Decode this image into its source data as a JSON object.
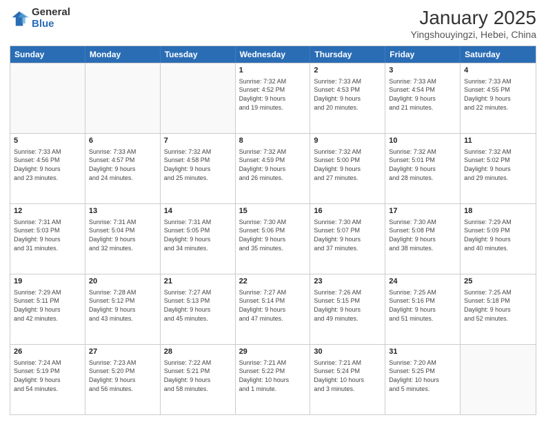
{
  "logo": {
    "general": "General",
    "blue": "Blue"
  },
  "header": {
    "month": "January 2025",
    "location": "Yingshouyingzi, Hebei, China"
  },
  "days_of_week": [
    "Sunday",
    "Monday",
    "Tuesday",
    "Wednesday",
    "Thursday",
    "Friday",
    "Saturday"
  ],
  "weeks": [
    [
      {
        "day": "",
        "info": "",
        "empty": true
      },
      {
        "day": "",
        "info": "",
        "empty": true
      },
      {
        "day": "",
        "info": "",
        "empty": true
      },
      {
        "day": "1",
        "info": "Sunrise: 7:32 AM\nSunset: 4:52 PM\nDaylight: 9 hours\nand 19 minutes.",
        "empty": false
      },
      {
        "day": "2",
        "info": "Sunrise: 7:33 AM\nSunset: 4:53 PM\nDaylight: 9 hours\nand 20 minutes.",
        "empty": false
      },
      {
        "day": "3",
        "info": "Sunrise: 7:33 AM\nSunset: 4:54 PM\nDaylight: 9 hours\nand 21 minutes.",
        "empty": false
      },
      {
        "day": "4",
        "info": "Sunrise: 7:33 AM\nSunset: 4:55 PM\nDaylight: 9 hours\nand 22 minutes.",
        "empty": false
      }
    ],
    [
      {
        "day": "5",
        "info": "Sunrise: 7:33 AM\nSunset: 4:56 PM\nDaylight: 9 hours\nand 23 minutes.",
        "empty": false
      },
      {
        "day": "6",
        "info": "Sunrise: 7:33 AM\nSunset: 4:57 PM\nDaylight: 9 hours\nand 24 minutes.",
        "empty": false
      },
      {
        "day": "7",
        "info": "Sunrise: 7:32 AM\nSunset: 4:58 PM\nDaylight: 9 hours\nand 25 minutes.",
        "empty": false
      },
      {
        "day": "8",
        "info": "Sunrise: 7:32 AM\nSunset: 4:59 PM\nDaylight: 9 hours\nand 26 minutes.",
        "empty": false
      },
      {
        "day": "9",
        "info": "Sunrise: 7:32 AM\nSunset: 5:00 PM\nDaylight: 9 hours\nand 27 minutes.",
        "empty": false
      },
      {
        "day": "10",
        "info": "Sunrise: 7:32 AM\nSunset: 5:01 PM\nDaylight: 9 hours\nand 28 minutes.",
        "empty": false
      },
      {
        "day": "11",
        "info": "Sunrise: 7:32 AM\nSunset: 5:02 PM\nDaylight: 9 hours\nand 29 minutes.",
        "empty": false
      }
    ],
    [
      {
        "day": "12",
        "info": "Sunrise: 7:31 AM\nSunset: 5:03 PM\nDaylight: 9 hours\nand 31 minutes.",
        "empty": false
      },
      {
        "day": "13",
        "info": "Sunrise: 7:31 AM\nSunset: 5:04 PM\nDaylight: 9 hours\nand 32 minutes.",
        "empty": false
      },
      {
        "day": "14",
        "info": "Sunrise: 7:31 AM\nSunset: 5:05 PM\nDaylight: 9 hours\nand 34 minutes.",
        "empty": false
      },
      {
        "day": "15",
        "info": "Sunrise: 7:30 AM\nSunset: 5:06 PM\nDaylight: 9 hours\nand 35 minutes.",
        "empty": false
      },
      {
        "day": "16",
        "info": "Sunrise: 7:30 AM\nSunset: 5:07 PM\nDaylight: 9 hours\nand 37 minutes.",
        "empty": false
      },
      {
        "day": "17",
        "info": "Sunrise: 7:30 AM\nSunset: 5:08 PM\nDaylight: 9 hours\nand 38 minutes.",
        "empty": false
      },
      {
        "day": "18",
        "info": "Sunrise: 7:29 AM\nSunset: 5:09 PM\nDaylight: 9 hours\nand 40 minutes.",
        "empty": false
      }
    ],
    [
      {
        "day": "19",
        "info": "Sunrise: 7:29 AM\nSunset: 5:11 PM\nDaylight: 9 hours\nand 42 minutes.",
        "empty": false
      },
      {
        "day": "20",
        "info": "Sunrise: 7:28 AM\nSunset: 5:12 PM\nDaylight: 9 hours\nand 43 minutes.",
        "empty": false
      },
      {
        "day": "21",
        "info": "Sunrise: 7:27 AM\nSunset: 5:13 PM\nDaylight: 9 hours\nand 45 minutes.",
        "empty": false
      },
      {
        "day": "22",
        "info": "Sunrise: 7:27 AM\nSunset: 5:14 PM\nDaylight: 9 hours\nand 47 minutes.",
        "empty": false
      },
      {
        "day": "23",
        "info": "Sunrise: 7:26 AM\nSunset: 5:15 PM\nDaylight: 9 hours\nand 49 minutes.",
        "empty": false
      },
      {
        "day": "24",
        "info": "Sunrise: 7:25 AM\nSunset: 5:16 PM\nDaylight: 9 hours\nand 51 minutes.",
        "empty": false
      },
      {
        "day": "25",
        "info": "Sunrise: 7:25 AM\nSunset: 5:18 PM\nDaylight: 9 hours\nand 52 minutes.",
        "empty": false
      }
    ],
    [
      {
        "day": "26",
        "info": "Sunrise: 7:24 AM\nSunset: 5:19 PM\nDaylight: 9 hours\nand 54 minutes.",
        "empty": false
      },
      {
        "day": "27",
        "info": "Sunrise: 7:23 AM\nSunset: 5:20 PM\nDaylight: 9 hours\nand 56 minutes.",
        "empty": false
      },
      {
        "day": "28",
        "info": "Sunrise: 7:22 AM\nSunset: 5:21 PM\nDaylight: 9 hours\nand 58 minutes.",
        "empty": false
      },
      {
        "day": "29",
        "info": "Sunrise: 7:21 AM\nSunset: 5:22 PM\nDaylight: 10 hours\nand 1 minute.",
        "empty": false
      },
      {
        "day": "30",
        "info": "Sunrise: 7:21 AM\nSunset: 5:24 PM\nDaylight: 10 hours\nand 3 minutes.",
        "empty": false
      },
      {
        "day": "31",
        "info": "Sunrise: 7:20 AM\nSunset: 5:25 PM\nDaylight: 10 hours\nand 5 minutes.",
        "empty": false
      },
      {
        "day": "",
        "info": "",
        "empty": true
      }
    ]
  ]
}
